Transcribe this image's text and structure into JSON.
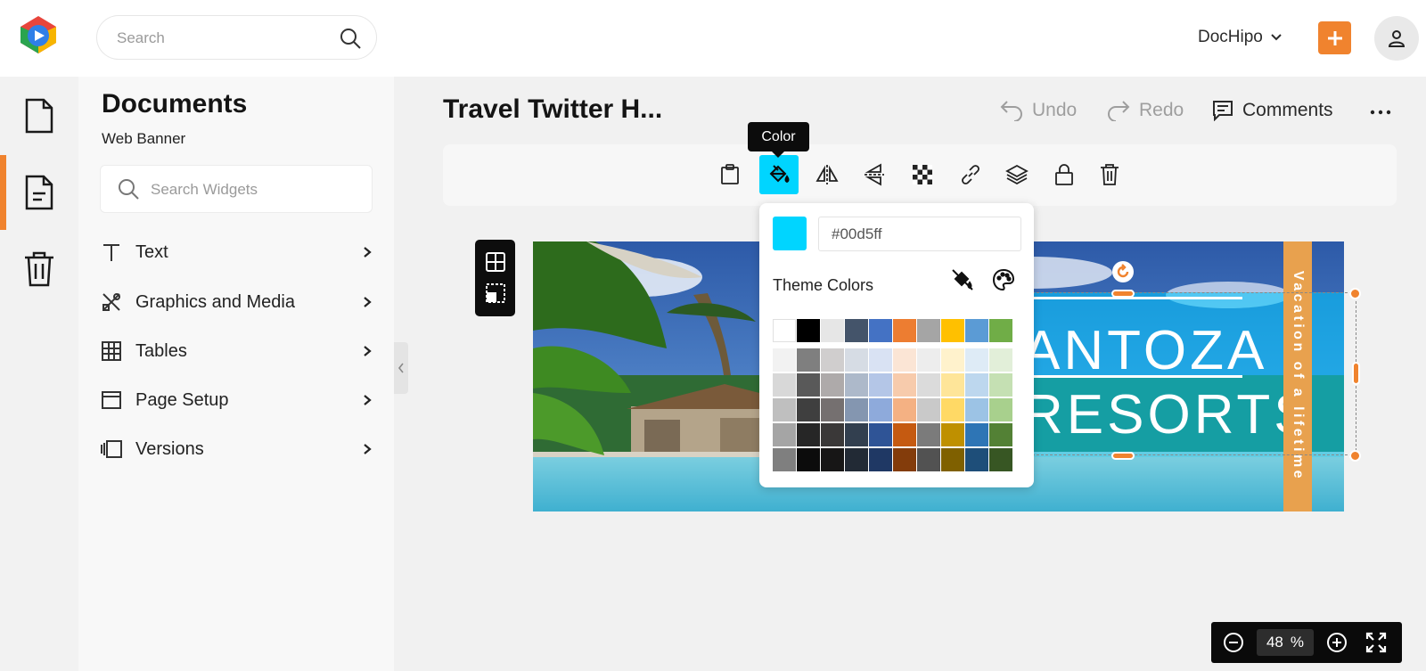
{
  "header": {
    "search_placeholder": "Search",
    "account_label": "DocHipo",
    "accent_color": "#f0832e"
  },
  "rail": {
    "items": [
      {
        "icon": "document-icon",
        "active": false
      },
      {
        "icon": "document-lines-icon",
        "active": true
      },
      {
        "icon": "trash-icon",
        "active": false
      }
    ]
  },
  "panel": {
    "title": "Documents",
    "subtitle": "Web Banner",
    "search_placeholder": "Search Widgets",
    "items": [
      {
        "label": "Text",
        "icon": "text-icon"
      },
      {
        "label": "Graphics and Media",
        "icon": "graphics-icon"
      },
      {
        "label": "Tables",
        "icon": "table-icon"
      },
      {
        "label": "Page Setup",
        "icon": "page-setup-icon"
      },
      {
        "label": "Versions",
        "icon": "versions-icon"
      }
    ]
  },
  "workspace": {
    "doc_title": "Travel Twitter H...",
    "undo_label": "Undo",
    "redo_label": "Redo",
    "comments_label": "Comments"
  },
  "toolbar": {
    "tooltip": "Color",
    "active_tool": "color",
    "tools": [
      "clipboard-icon",
      "paint-bucket-icon",
      "flip-horizontal-icon",
      "flip-vertical-icon",
      "transparency-icon",
      "link-icon",
      "layers-icon",
      "lock-icon",
      "delete-icon"
    ]
  },
  "banner": {
    "brand_line1": "ANTOZA",
    "brand_line2": "RESORTS",
    "tagline": "Vacation of a lifetime"
  },
  "color_picker": {
    "current_color": "#00d5ff",
    "hex_value": "#00d5ff",
    "theme_label": "Theme Colors",
    "base_colors": [
      "#ffffff",
      "#000000",
      "#e6e6e6",
      "#44546a",
      "#4472c4",
      "#ed7d31",
      "#a5a5a5",
      "#ffc000",
      "#5b9bd5",
      "#70ad47"
    ],
    "shades": [
      [
        "#f2f2f2",
        "#7f7f7f",
        "#d0cece",
        "#d6dce4",
        "#d9e2f3",
        "#fbe5d5",
        "#ededed",
        "#fff2cc",
        "#deebf6",
        "#e2efd9"
      ],
      [
        "#d8d8d8",
        "#595959",
        "#aeaaaa",
        "#adb9ca",
        "#b4c6e7",
        "#f7cbac",
        "#dbdbdb",
        "#fee599",
        "#bdd7ee",
        "#c5e0b3"
      ],
      [
        "#bfbfbf",
        "#3f3f3f",
        "#757070",
        "#8496b0",
        "#8eaadb",
        "#f4b183",
        "#c9c9c9",
        "#ffd965",
        "#9cc3e5",
        "#a8d08d"
      ],
      [
        "#a5a5a5",
        "#262626",
        "#3a3838",
        "#323f4f",
        "#2f5496",
        "#c55a11",
        "#7b7b7b",
        "#bf9000",
        "#2e75b5",
        "#538135"
      ],
      [
        "#7f7f7f",
        "#0c0c0c",
        "#171616",
        "#222a35",
        "#1f3864",
        "#833c0b",
        "#525252",
        "#7f6000",
        "#1e4e79",
        "#375623"
      ]
    ]
  },
  "zoom": {
    "value": "48",
    "unit": "%"
  }
}
